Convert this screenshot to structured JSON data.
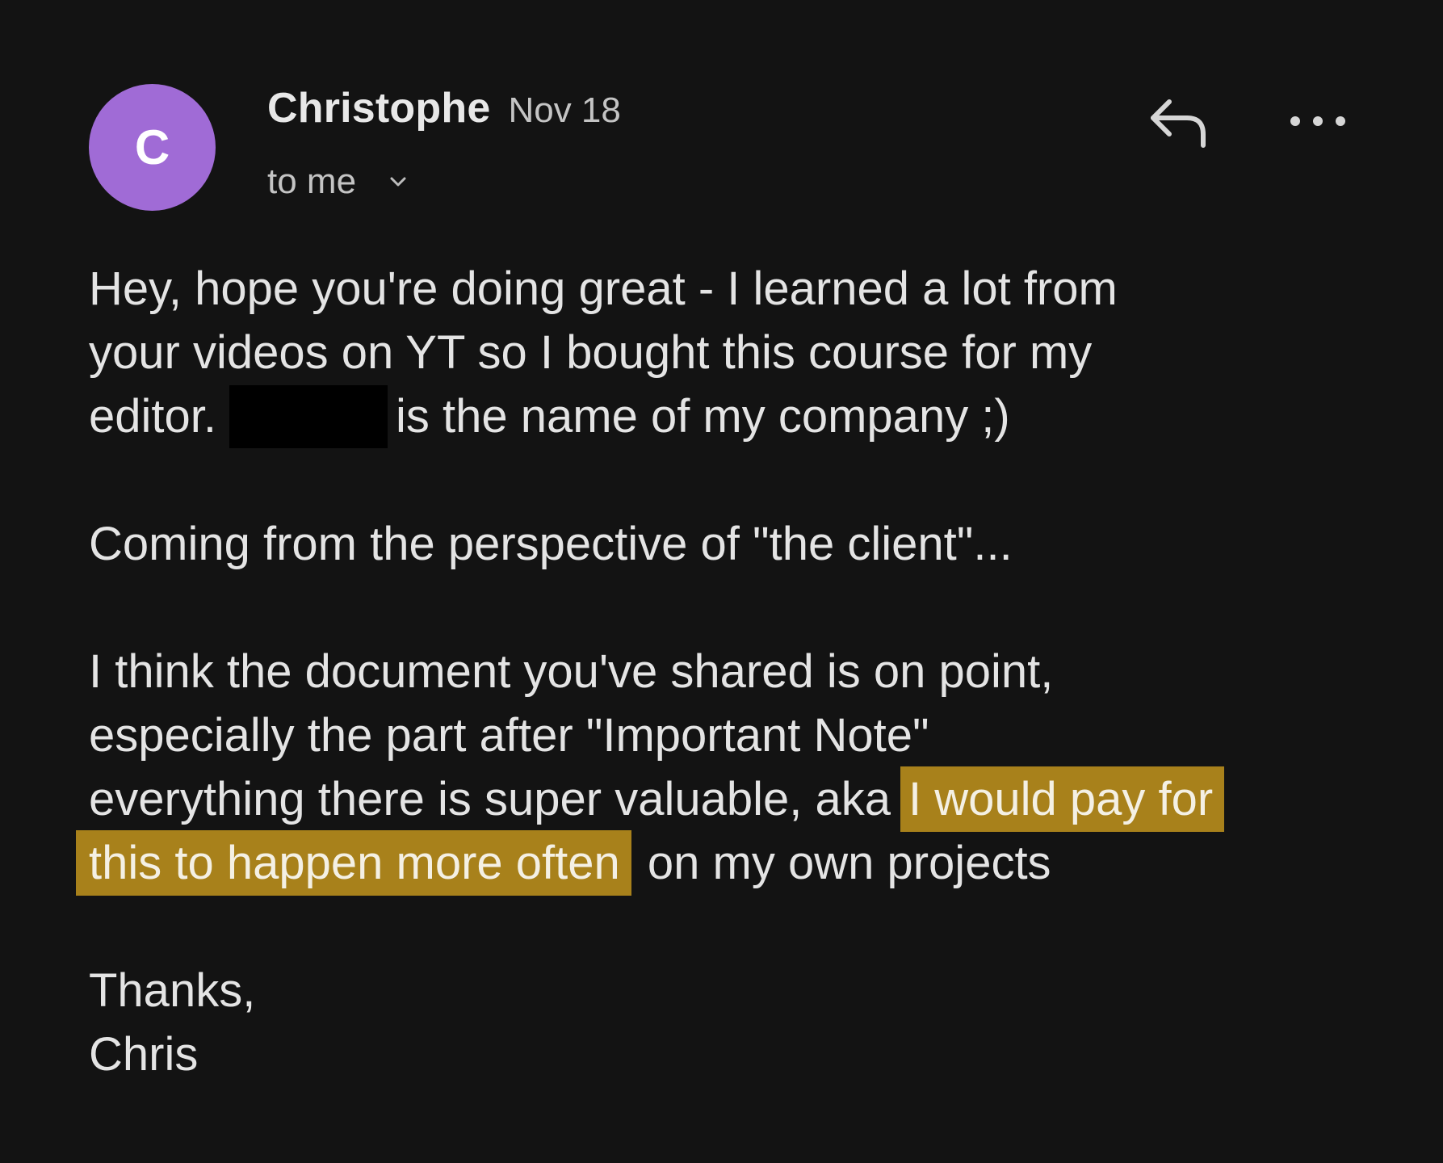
{
  "sender": {
    "avatar_initial": "C",
    "avatar_color": "#a06bd6",
    "name": "Christophe",
    "date": "Nov 18",
    "recipients": "to me"
  },
  "actions": {
    "reply_icon": "reply-icon",
    "more_icon": "more-options-icon",
    "expand_icon": "chevron-down-icon"
  },
  "highlight_color": "#a8811b",
  "message": {
    "p1_line1": "Hey, hope you're doing great - I learned a lot from",
    "p1_line2": "your videos on YT so I bought this course for my",
    "p1_line3_before": "editor.",
    "p1_line3_after": "is the name of my company ;)",
    "p2": "Coming from the perspective of \"the client\"...",
    "p3_line1": "I think the document you've shared is on point,",
    "p3_line2": "especially the part after \"Important Note\"",
    "p3_line3_before": "everything there is super valuable, aka",
    "p3_highlight_part1": "I would pay for",
    "p3_highlight_part2": "this to happen more often",
    "p3_line4_after": "on my own projects",
    "signoff": "Thanks,",
    "signature": "Chris"
  }
}
